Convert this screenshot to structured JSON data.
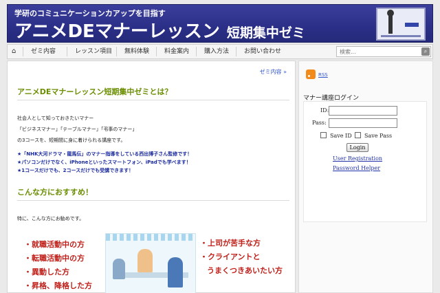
{
  "header": {
    "tagline": "学研のコミュニケーションカアップを目指す",
    "title": "アニメDEマナーレッスン",
    "subtitle": "短期集中ゼミ"
  },
  "nav": {
    "items": [
      "ゼミ内容",
      "レッスン項目",
      "無料体験",
      "料金案内",
      "購入方法",
      "お問い合わせ"
    ],
    "search_placeholder": "検索..."
  },
  "main": {
    "breadcrumb": "ゼミ内容 »",
    "heading1": "アニメDEマナーレッスン短期集中ゼミとは？",
    "lines": [
      "社会人として知っておきたいマナー",
      "「ビジネスマナー」「テーブルマナー」「弔事のマナー」",
      "の3コースを、短期間に身に着けられる講座です。"
    ],
    "highlights": [
      "★「NHK大河ドラマ・龍馬伝」のマナー指導をしている西出博子さん監修です！",
      "★パソコンだけでなく、iPhoneといったスマートフォン、iPadでも学べます！",
      "★1コースだけでも、2コースだけでも受講できます！"
    ],
    "heading2": "こんな方におすすめ！",
    "recommend_intro": "特に、こんな方にお勧めです。",
    "left_list": [
      "・就職活動中の方",
      "・転職活動中の方",
      "・異動した方",
      "・昇格、降格した方"
    ],
    "right_list": [
      "・上司が苦手な方",
      "・クライアントと",
      "うまくつきあいたい方"
    ]
  },
  "sidebar": {
    "rss_label": "RSS",
    "login_title": "マナー講座ログイン",
    "id_label": "ID:",
    "pass_label": "Pass:",
    "save_id": "Save ID",
    "save_pass": "Save Pass",
    "login_button": "Login",
    "user_registration": "User Registration",
    "password_helper": "Password Helper"
  }
}
